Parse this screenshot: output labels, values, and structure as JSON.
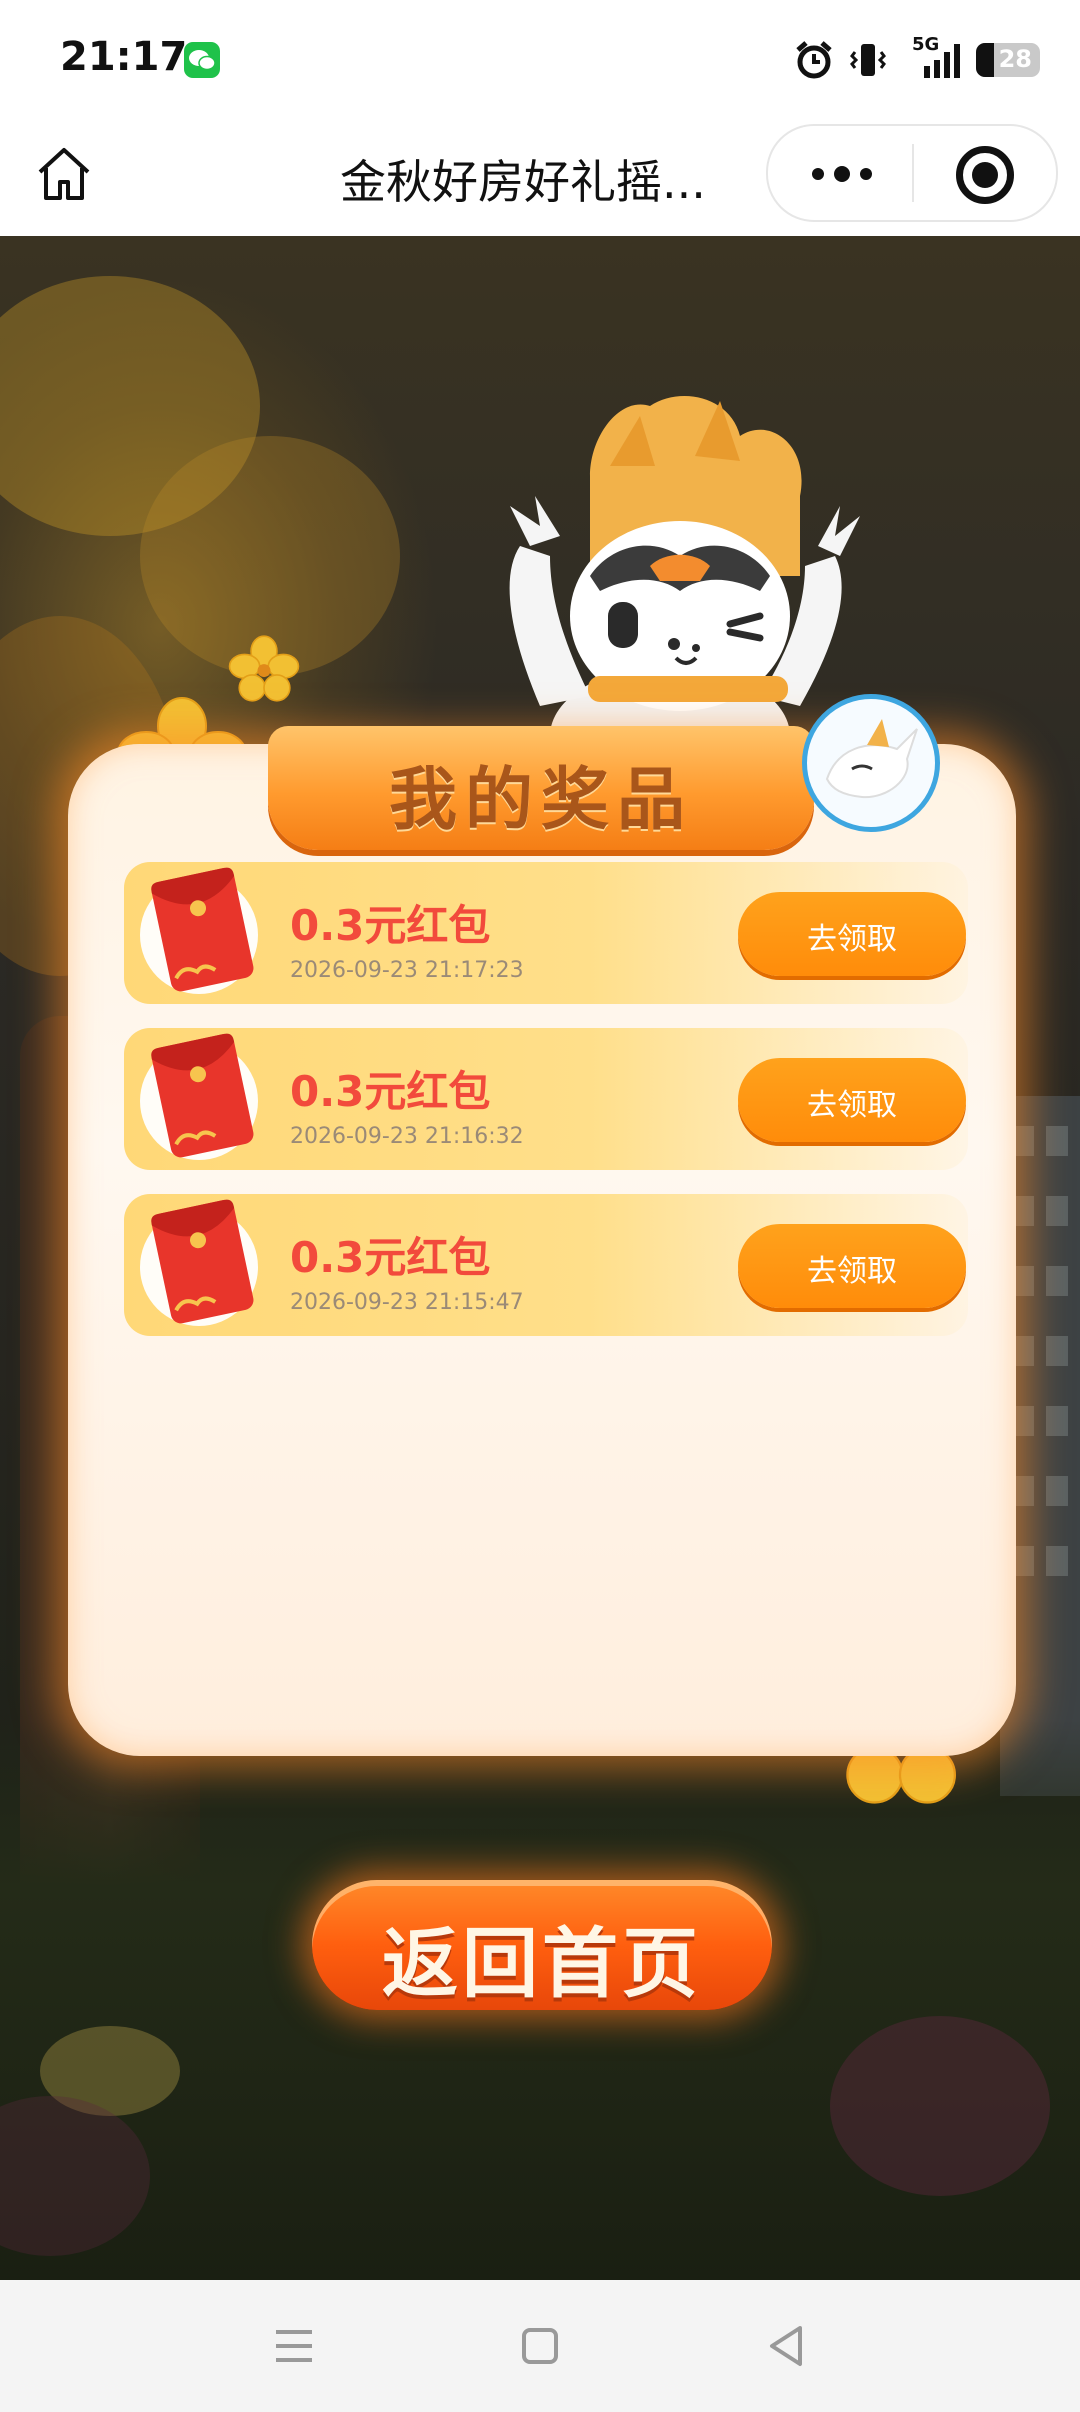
{
  "status_bar": {
    "time": "21:17",
    "network": "5G",
    "battery": "28",
    "icons": [
      "wechat-icon",
      "alarm-icon",
      "vibrate-icon",
      "signal-icon",
      "battery-icon"
    ]
  },
  "nav": {
    "title": "金秋好房好礼摇...",
    "icons": [
      "home-icon",
      "more-icon",
      "close-miniprogram-icon"
    ]
  },
  "panel": {
    "title": "我的奖品"
  },
  "prizes": [
    {
      "name": "0.3元红包",
      "time": "2026-09-23 21:17:23",
      "button": "去领取"
    },
    {
      "name": "0.3元红包",
      "time": "2026-09-23 21:16:32",
      "button": "去领取"
    },
    {
      "name": "0.3元红包",
      "time": "2026-09-23 21:15:47",
      "button": "去领取"
    }
  ],
  "back_home": "返回首页",
  "bottom_nav": {
    "icons": [
      "menu-icon",
      "home-square-icon",
      "back-triangle-icon"
    ]
  },
  "colors": {
    "accent_orange": "#ff8c0a",
    "prize_red": "#f24a3c",
    "panel_bg": "#fff3e3"
  }
}
